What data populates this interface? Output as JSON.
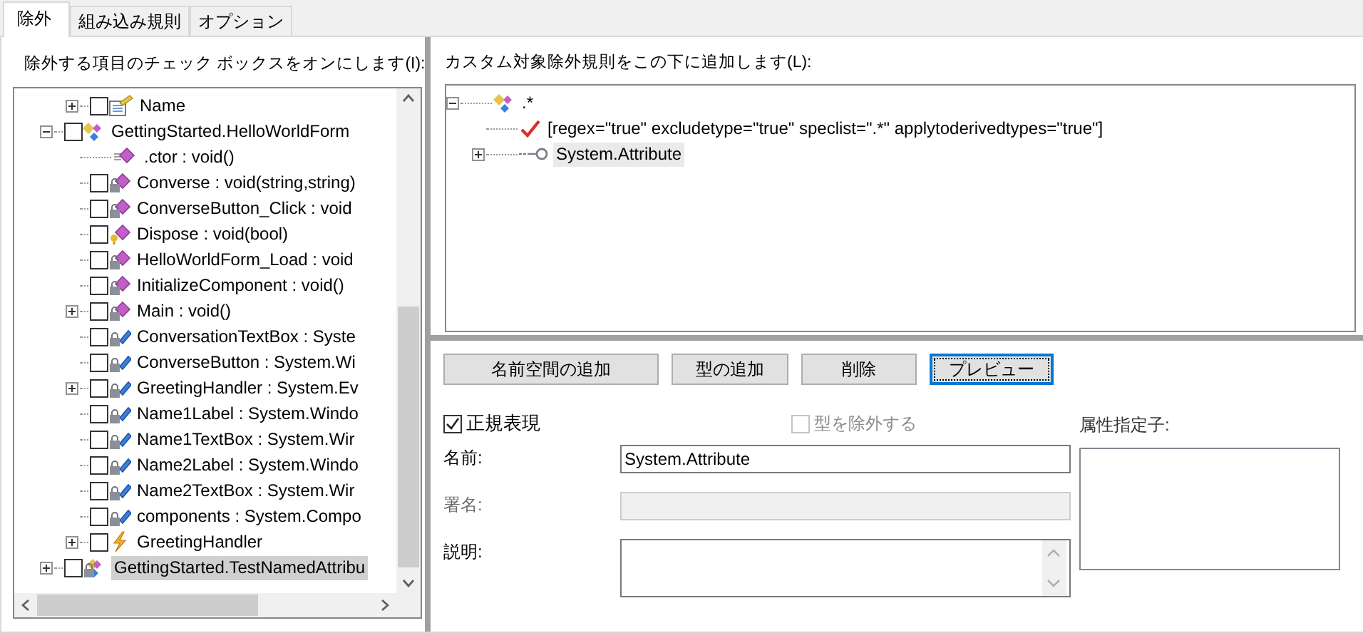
{
  "tabs": [
    {
      "label": "除外",
      "selected": true
    },
    {
      "label": "組み込み規則",
      "selected": false
    },
    {
      "label": "オプション",
      "selected": false
    }
  ],
  "left": {
    "label": "除外する項目のチェック ボックスをオンにします(I):",
    "tree": [
      {
        "children": [
          {
            "label": "Name",
            "kind": "property",
            "checked": false,
            "expanded": false,
            "selected": false
          }
        ]
      },
      {
        "label": "GettingStarted.HelloWorldForm",
        "kind": "class",
        "checked": false,
        "expanded": true,
        "selected": false,
        "children": [
          {
            "label": ".ctor : void()",
            "kind": "method",
            "selected": false
          },
          {
            "label": "Converse : void(string,string)",
            "kind": "private-method",
            "checked": false,
            "selected": false
          },
          {
            "label": "ConverseButton_Click : void",
            "kind": "private-method",
            "checked": false,
            "selected": false
          },
          {
            "label": "Dispose : void(bool)",
            "kind": "protected-method",
            "checked": false,
            "selected": false
          },
          {
            "label": "HelloWorldForm_Load : void",
            "kind": "private-method",
            "checked": false,
            "selected": false
          },
          {
            "label": "InitializeComponent : void()",
            "kind": "private-method",
            "checked": false,
            "selected": false
          },
          {
            "label": "Main : void()",
            "kind": "private-method",
            "checked": false,
            "expanded": false,
            "selected": false
          },
          {
            "label": "ConversationTextBox : Syste",
            "kind": "private-field",
            "checked": false,
            "selected": false
          },
          {
            "label": "ConverseButton : System.Wi",
            "kind": "private-field",
            "checked": false,
            "selected": false
          },
          {
            "label": "GreetingHandler : System.Ev",
            "kind": "private-field",
            "checked": false,
            "expanded": false,
            "selected": false
          },
          {
            "label": "Name1Label : System.Windo",
            "kind": "private-field",
            "checked": false,
            "selected": false
          },
          {
            "label": "Name1TextBox : System.Wir",
            "kind": "private-field",
            "checked": false,
            "selected": false
          },
          {
            "label": "Name2Label : System.Windo",
            "kind": "private-field",
            "checked": false,
            "selected": false
          },
          {
            "label": "Name2TextBox : System.Wir",
            "kind": "private-field",
            "checked": false,
            "selected": false
          },
          {
            "label": "components : System.Compo",
            "kind": "private-field",
            "checked": false,
            "selected": false
          },
          {
            "label": "GreetingHandler",
            "kind": "event",
            "checked": false,
            "expanded": false,
            "selected": false
          }
        ]
      },
      {
        "label": "GettingStarted.TestNamedAttribu",
        "kind": "private-class",
        "checked": false,
        "expanded": false,
        "selected": true
      }
    ]
  },
  "right": {
    "label": "カスタム対象除外規則をこの下に追加します(L):",
    "tree": [
      {
        "label": ".*",
        "kind": "class",
        "expanded": true,
        "selected": false,
        "children": [
          {
            "label": "[regex=\"true\" excludetype=\"true\" speclist=\".*\" applytoderivedtypes=\"true\"]",
            "kind": "rule",
            "selected": false
          },
          {
            "label": "System.Attribute",
            "kind": "type",
            "expanded": false,
            "selected": true
          }
        ]
      }
    ],
    "buttons": [
      {
        "label": "名前空間の追加",
        "focused": false
      },
      {
        "label": "型の追加",
        "focused": false
      },
      {
        "label": "削除",
        "focused": false
      },
      {
        "label": "プレビュー",
        "focused": true
      }
    ],
    "checkboxes": [
      {
        "label": "正規表現",
        "checked": true,
        "disabled": false
      },
      {
        "label": "型を除外する",
        "checked": false,
        "disabled": true
      }
    ],
    "fields": [
      {
        "label": "名前:",
        "value": "System.Attribute",
        "kind": "text",
        "disabled": false
      },
      {
        "label": "署名:",
        "kind": "text",
        "disabled": true
      },
      {
        "label": "説明:",
        "kind": "multiline",
        "disabled": false
      }
    ],
    "attributes": {
      "label": "属性指定子:"
    }
  }
}
